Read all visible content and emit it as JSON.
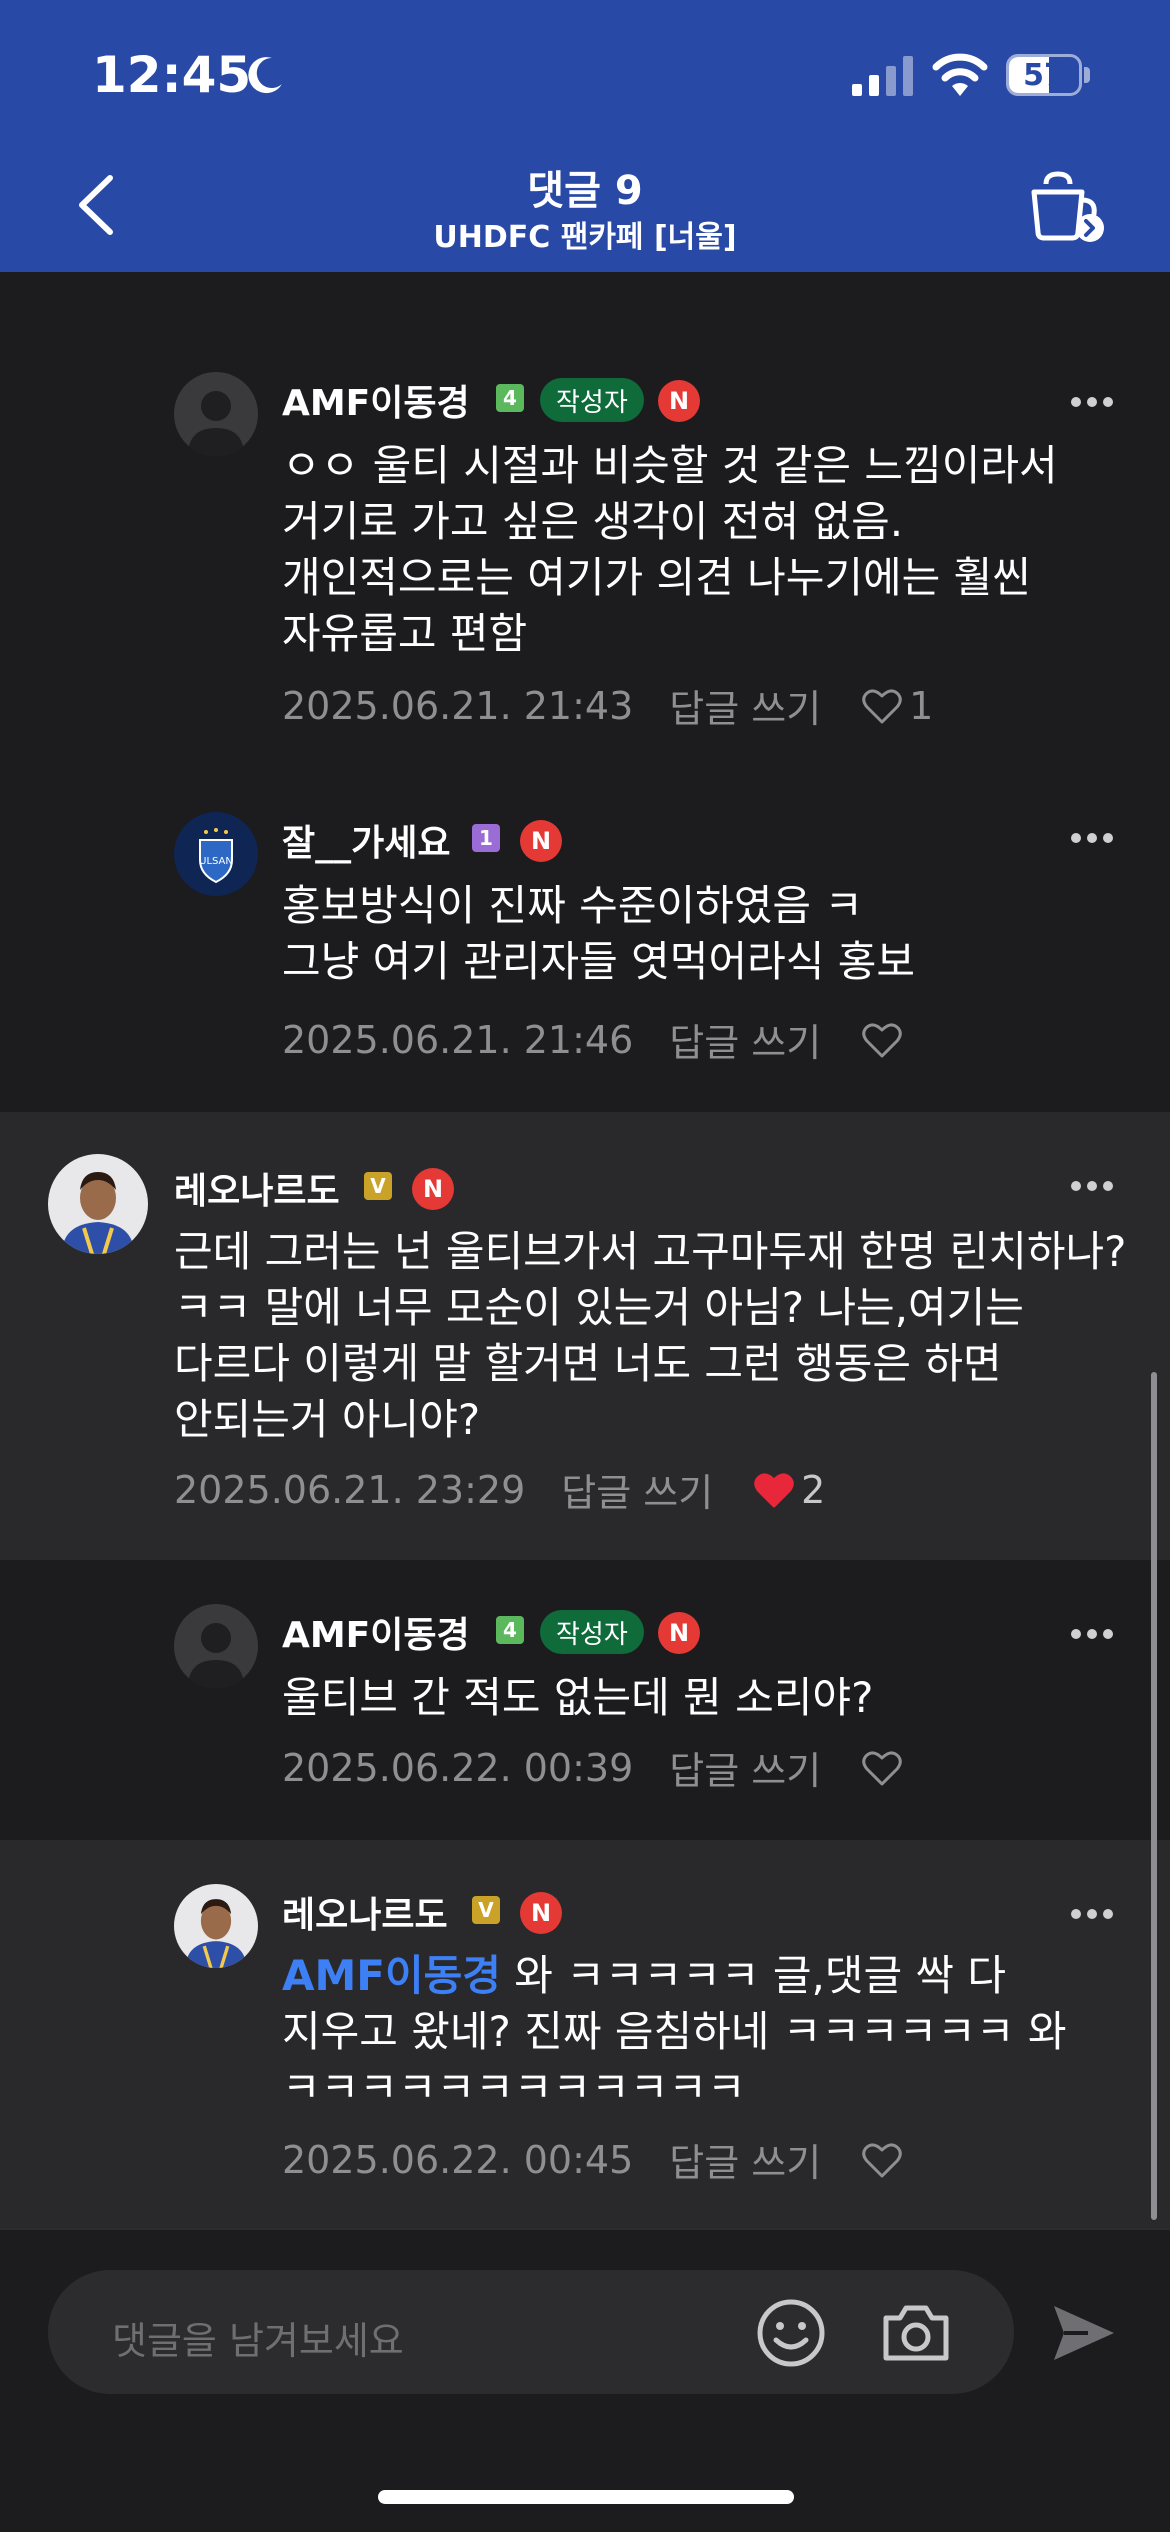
{
  "status_bar": {
    "time": "12:45",
    "battery_level": "57",
    "battery_fraction": 0.57
  },
  "nav": {
    "title": "댓글 9",
    "subtitle": "UHDFC 팬카페 [너울]"
  },
  "comments": [
    {
      "nickname": "AMF이동경",
      "level": "4",
      "writer_badge": "작성자",
      "n_badge": "N",
      "text": "ㅇㅇ 울티 시절과 비슷할 것 같은 느낌이라서 거기로 가고 싶은 생각이 전혀 없음. 개인적으로는 여기가 의견 나누기에는 훨씬 자유롭고 편함",
      "date": "2025.06.21. 21:43",
      "reply_label": "답글 쓰기",
      "likes": "1",
      "liked": false
    },
    {
      "nickname": "잘__가세요",
      "level": "1",
      "n_badge": "N",
      "text_lines": [
        "홍보방식이 진짜 수준이하였음 ㅋ",
        "그냥 여기 관리자들 엿먹어라식 홍보"
      ],
      "date": "2025.06.21. 21:46",
      "reply_label": "답글 쓰기",
      "likes": "",
      "liked": false
    },
    {
      "nickname": "레오나르도",
      "level": "V",
      "n_badge": "N",
      "text": "근데 그러는 넌 울티브가서 고구마두재 한명 린치하나?ㅋㅋ 말에 너무 모순이 있는거 아님? 나는,여기는 다르다 이렇게 말 할거면 너도 그런 행동은 하면 안되는거 아니야?",
      "date": "2025.06.21. 23:29",
      "reply_label": "답글 쓰기",
      "likes": "2",
      "liked": true
    },
    {
      "nickname": "AMF이동경",
      "level": "4",
      "writer_badge": "작성자",
      "n_badge": "N",
      "text": "울티브 간 적도 없는데 뭔 소리야?",
      "date": "2025.06.22. 00:39",
      "reply_label": "답글 쓰기",
      "likes": "",
      "liked": false
    },
    {
      "nickname": "레오나르도",
      "level": "V",
      "n_badge": "N",
      "mention": "AMF이동경",
      "text": " 와 ㅋㅋㅋㅋㅋ 글,댓글 싹 다 지우고 왔네? 진짜 음침하네 ㅋㅋㅋㅋㅋㅋ 와 ㅋㅋㅋㅋㅋㅋㅋㅋㅋㅋㅋㅋ",
      "date": "2025.06.22. 00:45",
      "reply_label": "답글 쓰기",
      "likes": "",
      "liked": false
    }
  ],
  "input": {
    "placeholder": "댓글을 남겨보세요"
  },
  "colors": {
    "header_bg": "#2849a6",
    "page_bg": "#1c1c1e",
    "highlight_bg": "#29292c",
    "writer_badge": "#0f6b3a",
    "n_badge": "#e53935",
    "mention": "#3d7ff5",
    "like_active": "#e8283a",
    "level_4": "#5cb85c",
    "level_1": "#9b6cd6",
    "level_v": "#c9a227"
  },
  "icons": [
    "moon-icon",
    "signal-icon",
    "wifi-icon",
    "battery-icon",
    "back-arrow-icon",
    "cafe-cup-icon",
    "more-icon",
    "heart-icon",
    "emoji-icon",
    "camera-icon",
    "send-icon"
  ]
}
